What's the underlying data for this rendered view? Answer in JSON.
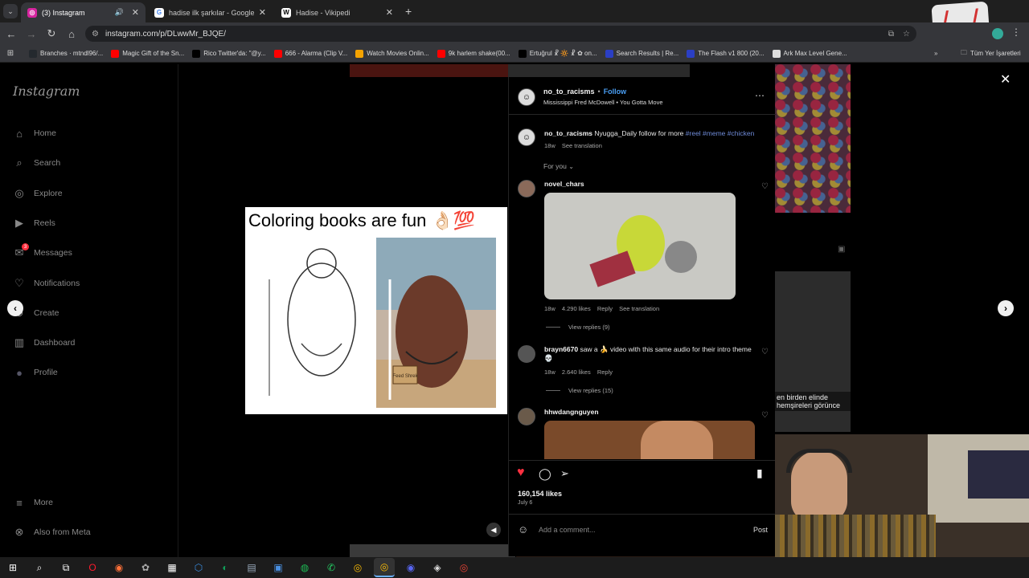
{
  "browser": {
    "tabs": [
      {
        "title": "(3) Instagram",
        "favicon": "instagram-icon",
        "color": "#d6249f",
        "active": true
      },
      {
        "title": "hadise ilk şarkılar - Google'da A",
        "favicon": "google-icon",
        "color": "#4285f4",
        "active": false
      },
      {
        "title": "Hadise - Vikipedi",
        "favicon": "wikipedia-icon",
        "color": "#ffffff",
        "active": false
      }
    ],
    "url": "instagram.com/p/DLwwMr_BJQE/",
    "bookmarks": [
      {
        "label": "Branches · mtndl96/...",
        "icon": "github-icon",
        "color": "#24292e"
      },
      {
        "label": "Magic Gift of the Sn...",
        "icon": "youtube-icon",
        "color": "#ff0000"
      },
      {
        "label": "Rico Twitter'da: \"@y...",
        "icon": "x-icon",
        "color": "#000000"
      },
      {
        "label": "666 - Alarma (Clip V...",
        "icon": "youtube-icon",
        "color": "#ff0000"
      },
      {
        "label": "Watch Movies Onlin...",
        "icon": "hd-icon",
        "color": "#f4a300"
      },
      {
        "label": "9k harlem shake(00...",
        "icon": "youtube-icon",
        "color": "#ff0000"
      },
      {
        "label": "Ertuğrul ☧ 🔆 ☧ ✿ on...",
        "icon": "x-icon",
        "color": "#000000"
      },
      {
        "label": "Search Results | Re...",
        "icon": "al-icon",
        "color": "#2b3fc4"
      },
      {
        "label": "The Flash v1 800 (20...",
        "icon": "al-icon",
        "color": "#2b3fc4"
      },
      {
        "label": "Ark Max Level Gene...",
        "icon": "page-icon",
        "color": "#dddddd"
      }
    ],
    "all_bookmarks": "Tüm Yer İşaretleri"
  },
  "sidebar": {
    "logo": "Instagram",
    "items": [
      {
        "label": "Home",
        "icon": "home-icon"
      },
      {
        "label": "Search",
        "icon": "search-icon"
      },
      {
        "label": "Explore",
        "icon": "compass-icon"
      },
      {
        "label": "Reels",
        "icon": "reels-icon"
      },
      {
        "label": "Messages",
        "icon": "messages-icon",
        "badge": "3"
      },
      {
        "label": "Notifications",
        "icon": "heart-icon"
      },
      {
        "label": "Create",
        "icon": "plus-icon"
      },
      {
        "label": "Dashboard",
        "icon": "dashboard-icon"
      },
      {
        "label": "Profile",
        "icon": "avatar-icon"
      }
    ],
    "more": "More",
    "meta": "Also from Meta"
  },
  "post": {
    "image_caption": "Coloring books are fun 👌🏻💯",
    "sign_text": "Feed Shrek"
  },
  "panel": {
    "author": "no_to_racisms",
    "follow": "Follow",
    "audio": "Mississippi Fred McDowell • You Gotta Move",
    "caption": {
      "author": "no_to_racisms",
      "text": "Nyugga_Daily follow for more",
      "tags": "#reel #meme #chicken",
      "time": "18w",
      "translate": "See translation"
    },
    "filter": "For you",
    "comments": [
      {
        "user": "novel_chars",
        "time": "18w",
        "likes": "4.290 likes",
        "reply": "Reply",
        "translate": "See translation",
        "view_replies": "View replies (9)"
      },
      {
        "user": "brayn6670",
        "text": "saw a 🍌 video with this same audio for their intro theme 💀",
        "time": "18w",
        "likes": "2.640 likes",
        "reply": "Reply",
        "view_replies": "View replies (15)"
      },
      {
        "user": "hhwdangnguyen"
      }
    ],
    "likes": "160,154 likes",
    "date": "July 6",
    "comment_placeholder": "Add a comment...",
    "post_button": "Post"
  },
  "overlay": {
    "bg_text": "en birden elinde\nhemşireleri görünce"
  }
}
